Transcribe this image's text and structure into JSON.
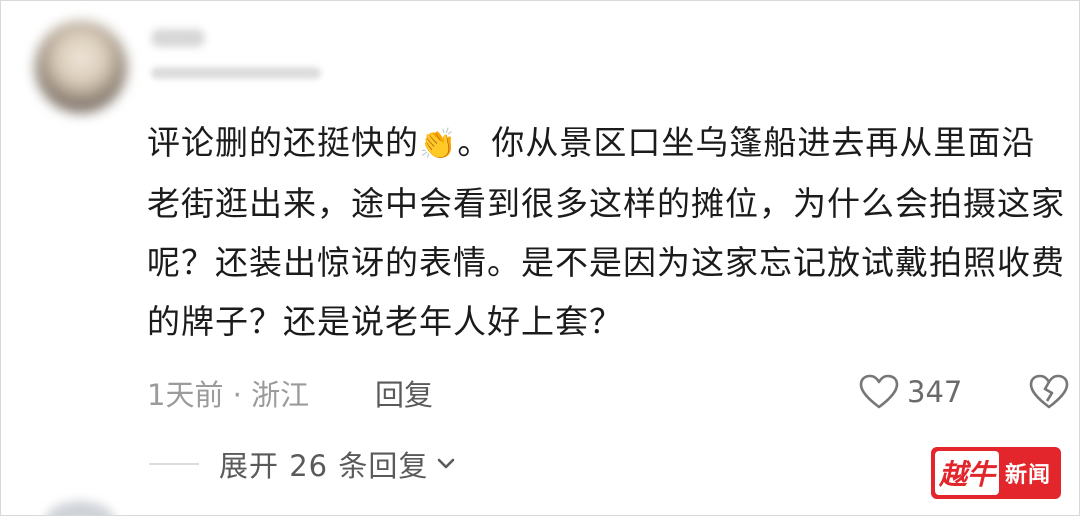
{
  "comment": {
    "username": "",
    "text_before_emoji": "评论删的还挺快的",
    "emoji": "👏",
    "text_after_emoji": "。你从景区口坐乌篷船进去再从里面沿老街逛出来，途中会看到很多这样的摊位，为什么会拍摄这家呢？还装出惊讶的表情。是不是因为这家忘记放试戴拍照收费的牌子？还是说老年人好上套？",
    "time_location": "1天前 · 浙江",
    "reply_label": "回复",
    "like_count": "347",
    "expand_label": "展开 26 条回复"
  },
  "icons": {
    "like": "heart-outline-icon",
    "dislike": "broken-heart-icon",
    "expand": "chevron-down-icon"
  },
  "watermark": {
    "mark": "越牛",
    "text": "新闻",
    "color": "#e2262b"
  }
}
